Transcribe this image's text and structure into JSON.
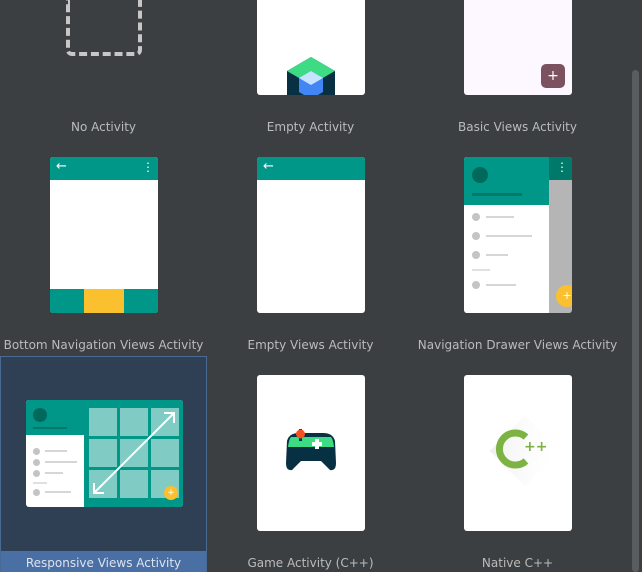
{
  "templates": [
    {
      "label": "No Activity"
    },
    {
      "label": "Empty Activity"
    },
    {
      "label": "Basic Views Activity",
      "fab": "+"
    },
    {
      "label": "Bottom Navigation Views Activity"
    },
    {
      "label": "Empty Views Activity"
    },
    {
      "label": "Navigation Drawer Views Activity",
      "fab": "+"
    },
    {
      "label": "Responsive Views Activity",
      "fab": "+"
    },
    {
      "label": "Game Activity (C++)"
    },
    {
      "label": "Native C++",
      "logo_text": "++"
    }
  ],
  "selected_template": "Responsive Views Activity",
  "icons": {
    "back_arrow": "←",
    "overflow_menu": "⋮"
  },
  "colors": {
    "background": "#3c3f41",
    "selection": "#4a6fa5",
    "teal_primary": "#009688",
    "accent_yellow": "#fbc02d"
  }
}
